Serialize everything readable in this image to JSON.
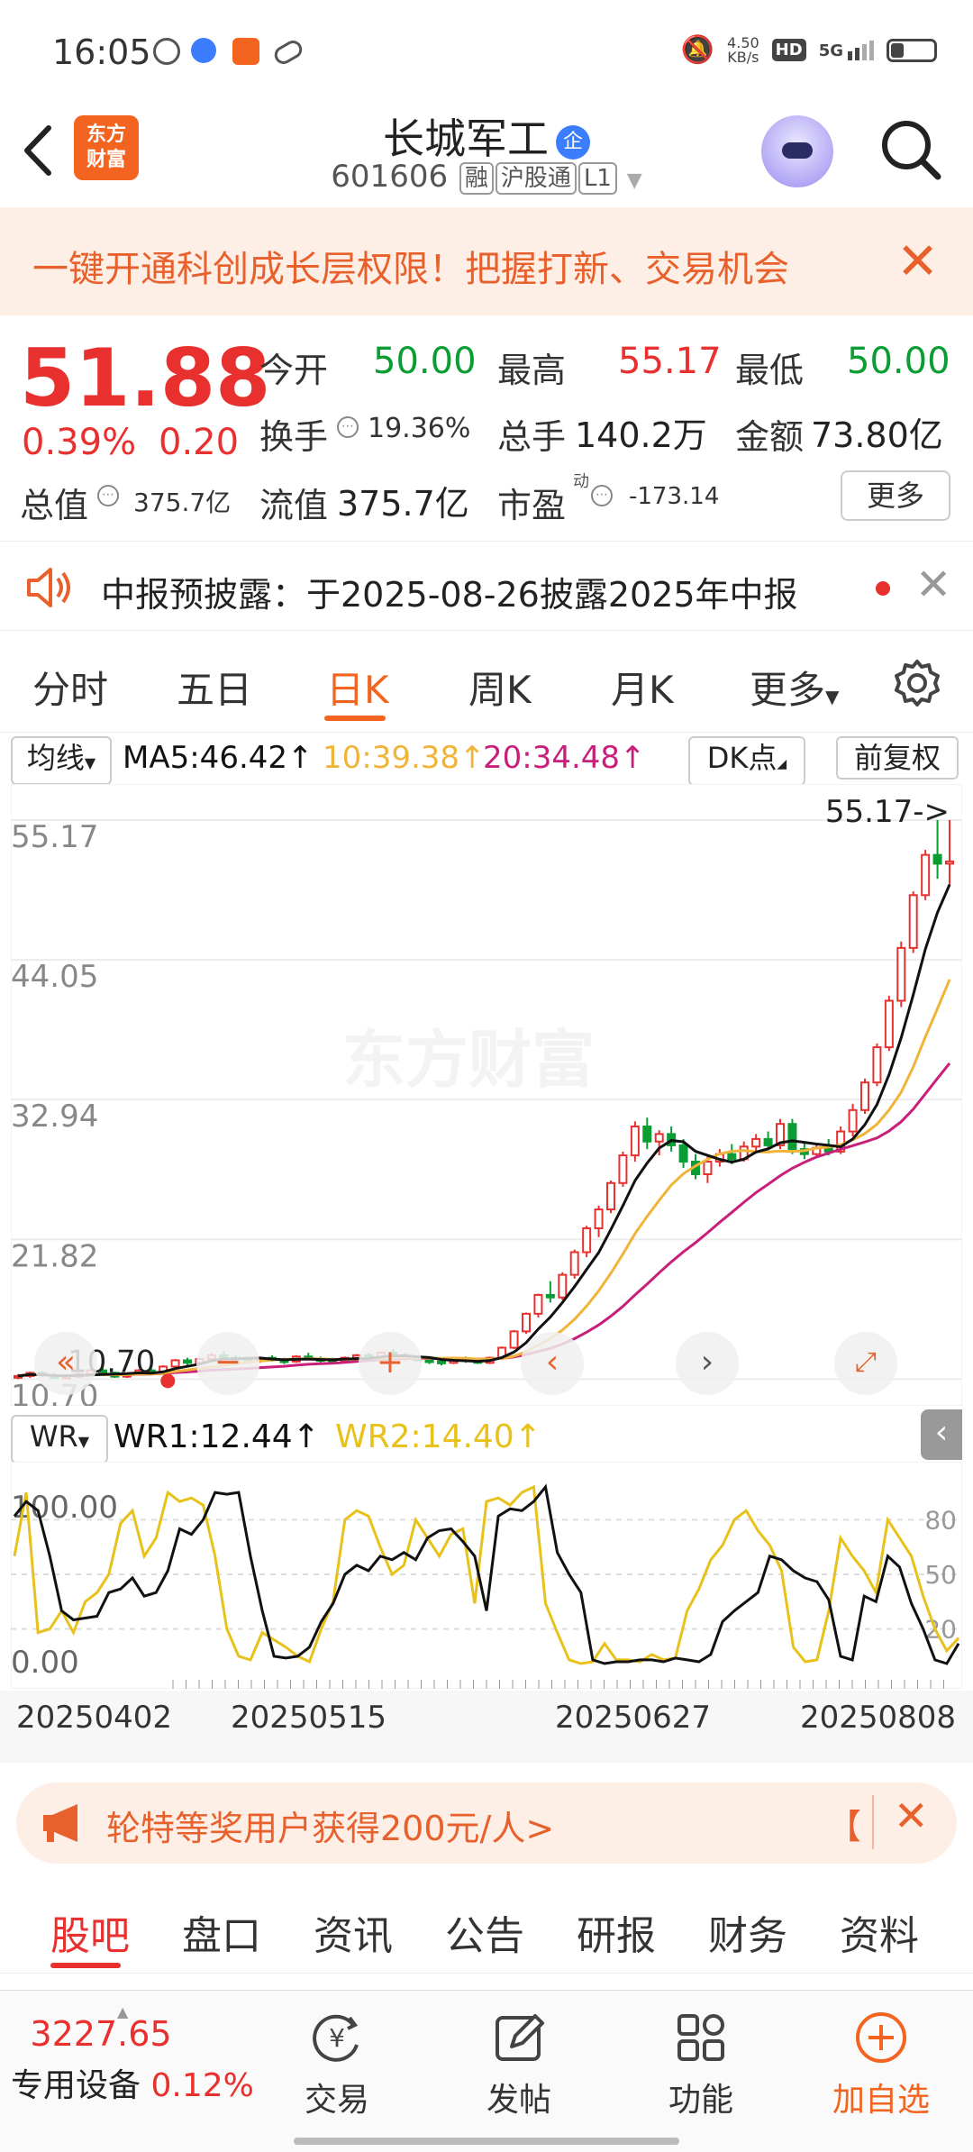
{
  "status": {
    "time": "16:05",
    "net_speed": "4.50\nKB/s",
    "hd": "HD",
    "network": "5G"
  },
  "header": {
    "logo": "东方\n财富",
    "name": "长城军工",
    "corp_badge": "企",
    "code": "601606",
    "tags": [
      "融",
      "沪股通",
      "L1"
    ]
  },
  "banner": {
    "text": "一键开通科创成长层权限！把握打新、交易机会"
  },
  "quote": {
    "price": "51.88",
    "pct": "0.39%",
    "change": "0.20",
    "open_label": "今开",
    "open": "50.00",
    "high_label": "最高",
    "high": "55.17",
    "low_label": "最低",
    "low": "50.00",
    "turnover_label": "换手",
    "turnover": "19.36%",
    "volume_label": "总手",
    "volume": "140.2万",
    "amount_label": "金额",
    "amount": "73.80亿",
    "mktcap_label": "总值",
    "mktcap": "375.7亿",
    "float_label": "流值",
    "float": "375.7亿",
    "pe_label": "市盈",
    "pe_sup": "动",
    "pe": "-173.14",
    "more": "更多"
  },
  "notice": {
    "text": "中报预披露：于2025-08-26披露2025年中报"
  },
  "period_tabs": [
    "分时",
    "五日",
    "日K",
    "周K",
    "月K",
    "更多"
  ],
  "ma_row": {
    "selector": "均线",
    "ma5": "MA5:46.42↑",
    "ma10": "10:39.38↑",
    "ma20": "20:34.48↑",
    "dk": "DK点",
    "adjust": "前复权"
  },
  "colors": {
    "up": "#e8312f",
    "down": "#0a9d34",
    "ma5": "#111111",
    "ma10": "#f0b43a",
    "ma20": "#c8207a",
    "accent": "#f2641f"
  },
  "chart_data": [
    {
      "type": "candlestick",
      "y_ticks": [
        "55.17",
        "44.05",
        "32.94",
        "21.82",
        "10.70"
      ],
      "ylim": [
        10.7,
        55.17
      ],
      "max_label": "55.17->",
      "min_label": "10.70",
      "watermark": "东方财富",
      "x_labels": [
        "20250402",
        "20250515",
        "20250627",
        "20250808"
      ],
      "candles": [
        [
          10.9,
          11.1,
          10.7,
          10.95
        ],
        [
          10.95,
          11.3,
          10.8,
          11.2
        ],
        [
          11.2,
          11.3,
          10.9,
          11.0
        ],
        [
          11.0,
          11.2,
          10.7,
          10.8
        ],
        [
          10.8,
          11.0,
          10.7,
          10.9
        ],
        [
          10.9,
          11.2,
          10.8,
          11.1
        ],
        [
          11.1,
          11.5,
          11.0,
          11.4
        ],
        [
          11.4,
          11.6,
          11.1,
          11.2
        ],
        [
          11.2,
          11.3,
          10.8,
          10.9
        ],
        [
          10.9,
          11.2,
          10.8,
          11.1
        ],
        [
          11.1,
          11.5,
          11.0,
          11.4
        ],
        [
          11.4,
          11.6,
          11.2,
          11.3
        ],
        [
          11.3,
          11.8,
          11.2,
          11.7
        ],
        [
          11.7,
          12.3,
          11.6,
          12.2
        ],
        [
          12.2,
          12.4,
          11.8,
          12.0
        ],
        [
          12.0,
          12.4,
          11.9,
          12.3
        ],
        [
          12.3,
          12.8,
          12.1,
          12.6
        ],
        [
          12.6,
          12.9,
          12.3,
          12.4
        ],
        [
          12.4,
          12.6,
          12.1,
          12.3
        ],
        [
          12.3,
          12.5,
          12.0,
          12.2
        ],
        [
          12.2,
          12.5,
          12.0,
          12.4
        ],
        [
          12.4,
          12.6,
          12.1,
          12.2
        ],
        [
          12.2,
          12.4,
          11.9,
          12.1
        ],
        [
          12.1,
          12.6,
          12.0,
          12.5
        ],
        [
          12.5,
          12.8,
          12.2,
          12.3
        ],
        [
          12.3,
          12.5,
          12.0,
          12.2
        ],
        [
          12.2,
          12.4,
          11.9,
          12.1
        ],
        [
          12.1,
          12.5,
          12.0,
          12.4
        ],
        [
          12.4,
          12.7,
          12.2,
          12.6
        ],
        [
          12.6,
          12.8,
          12.3,
          12.4
        ],
        [
          12.4,
          12.9,
          12.3,
          12.8
        ],
        [
          12.8,
          13.1,
          12.5,
          12.6
        ],
        [
          12.6,
          12.8,
          12.2,
          12.4
        ],
        [
          12.4,
          12.6,
          12.1,
          12.2
        ],
        [
          12.2,
          12.4,
          11.9,
          12.1
        ],
        [
          12.1,
          12.3,
          11.8,
          12.0
        ],
        [
          12.0,
          12.4,
          11.9,
          12.3
        ],
        [
          12.3,
          12.5,
          12.0,
          12.2
        ],
        [
          12.2,
          12.4,
          11.9,
          12.0
        ],
        [
          12.0,
          12.5,
          11.9,
          12.4
        ],
        [
          12.4,
          13.3,
          12.3,
          13.2
        ],
        [
          13.2,
          14.6,
          13.1,
          14.5
        ],
        [
          14.5,
          16.0,
          14.3,
          15.9
        ],
        [
          15.9,
          17.5,
          15.6,
          17.4
        ],
        [
          17.4,
          18.5,
          16.8,
          17.2
        ],
        [
          17.2,
          19.2,
          17.0,
          19.0
        ],
        [
          19.0,
          21.0,
          18.7,
          20.8
        ],
        [
          20.8,
          22.9,
          20.4,
          22.7
        ],
        [
          22.7,
          24.5,
          22.0,
          24.2
        ],
        [
          24.2,
          26.5,
          23.9,
          26.3
        ],
        [
          26.3,
          28.8,
          26.0,
          28.5
        ],
        [
          28.5,
          31.2,
          28.0,
          30.8
        ],
        [
          30.8,
          31.5,
          29.0,
          29.6
        ],
        [
          29.6,
          30.5,
          28.5,
          30.2
        ],
        [
          30.2,
          30.8,
          28.8,
          29.3
        ],
        [
          29.3,
          29.8,
          27.5,
          28.0
        ],
        [
          28.0,
          28.6,
          26.6,
          27.0
        ],
        [
          27.0,
          28.4,
          26.3,
          28.0
        ],
        [
          28.0,
          29.0,
          27.6,
          28.6
        ],
        [
          28.6,
          29.4,
          27.8,
          28.2
        ],
        [
          28.2,
          29.6,
          28.0,
          29.2
        ],
        [
          29.2,
          30.2,
          28.8,
          29.8
        ],
        [
          29.8,
          30.4,
          28.9,
          29.3
        ],
        [
          29.3,
          31.4,
          29.0,
          31.0
        ],
        [
          31.0,
          31.4,
          28.6,
          29.0
        ],
        [
          29.0,
          29.6,
          28.2,
          28.6
        ],
        [
          28.6,
          29.4,
          28.3,
          29.1
        ],
        [
          29.1,
          29.8,
          28.5,
          28.8
        ],
        [
          28.8,
          30.8,
          28.6,
          30.4
        ],
        [
          30.4,
          32.6,
          30.0,
          32.1
        ],
        [
          32.1,
          34.6,
          31.8,
          34.3
        ],
        [
          34.3,
          37.4,
          34.0,
          37.1
        ],
        [
          37.1,
          41.2,
          36.8,
          40.8
        ],
        [
          40.8,
          45.5,
          40.3,
          45.0
        ],
        [
          45.0,
          49.5,
          44.6,
          49.2
        ],
        [
          49.2,
          52.8,
          48.8,
          52.4
        ],
        [
          52.4,
          55.17,
          50.5,
          51.7
        ],
        [
          51.7,
          55.17,
          50.0,
          51.88
        ]
      ],
      "ma5_end": "46.42",
      "ma10_end": "39.38",
      "ma20_end": "34.48"
    },
    {
      "type": "line",
      "title": "WR",
      "series": [
        {
          "name": "WR1",
          "value_label": "WR1:12.44↑",
          "color": "#111111"
        },
        {
          "name": "WR2",
          "value_label": "WR2:14.40↑",
          "color": "#e8c21a"
        }
      ],
      "y_ticks_left": [
        "100.00",
        "0.00"
      ],
      "y_ticks_right": [
        "80",
        "50",
        "20"
      ],
      "ylim": [
        0,
        100
      ],
      "wr1": [
        82,
        90,
        85,
        60,
        30,
        25,
        26,
        27,
        40,
        42,
        48,
        38,
        40,
        52,
        75,
        72,
        80,
        95,
        94,
        95,
        60,
        30,
        5,
        4,
        5,
        10,
        24,
        34,
        50,
        55,
        52,
        60,
        58,
        62,
        58,
        70,
        74,
        75,
        68,
        60,
        30,
        82,
        86,
        85,
        90,
        98,
        62,
        50,
        40,
        3,
        1,
        2,
        2,
        3,
        3,
        2,
        4,
        3,
        2,
        6,
        24,
        30,
        35,
        40,
        60,
        58,
        52,
        48,
        46,
        36,
        5,
        3,
        38,
        35,
        60,
        54,
        34,
        20,
        3,
        1,
        12
      ],
      "wr2": [
        60,
        95,
        18,
        20,
        30,
        18,
        35,
        40,
        50,
        78,
        85,
        60,
        70,
        95,
        90,
        92,
        88,
        60,
        20,
        5,
        3,
        18,
        14,
        10,
        5,
        2,
        20,
        35,
        80,
        85,
        82,
        65,
        50,
        55,
        80,
        70,
        60,
        72,
        75,
        34,
        90,
        92,
        88,
        95,
        98,
        34,
        18,
        3,
        1,
        2,
        12,
        3,
        3,
        2,
        6,
        3,
        4,
        30,
        42,
        58,
        66,
        80,
        85,
        74,
        66,
        52,
        10,
        2,
        3,
        30,
        70,
        60,
        52,
        40,
        80,
        70,
        60,
        38,
        20,
        8,
        15
      ]
    }
  ],
  "wr_row": {
    "selector": "WR",
    "wr1": "WR1:12.44↑",
    "wr2": "WR2:14.40↑"
  },
  "promo": {
    "text": "轮特等奖用户获得200元/人>",
    "right": "【"
  },
  "bottom_tabs": [
    "股吧",
    "盘口",
    "资讯",
    "公告",
    "研报",
    "财务",
    "资料"
  ],
  "bottom_bar": {
    "index_value": "3227.65",
    "index_name": "专用设备",
    "index_pct": "0.12%",
    "trade": "交易",
    "post": "发帖",
    "func": "功能",
    "watch": "加自选"
  }
}
